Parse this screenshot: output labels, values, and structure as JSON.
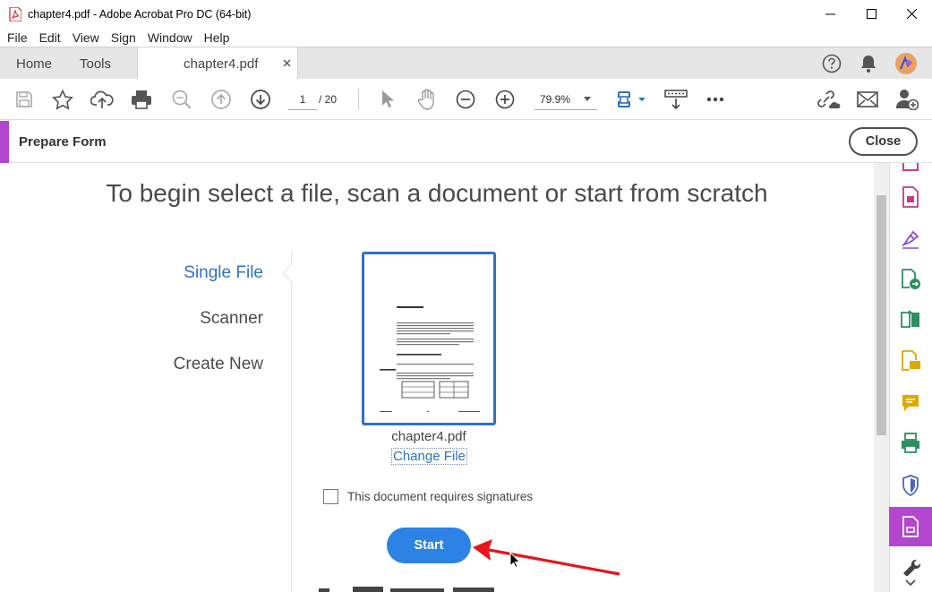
{
  "window": {
    "title": "chapter4.pdf - Adobe Acrobat Pro DC (64-bit)",
    "icons": {
      "app": "acrobat-pdf-icon",
      "minimize": "minimize-icon",
      "maximize": "maximize-icon",
      "close": "close-icon"
    }
  },
  "menu": [
    "File",
    "Edit",
    "View",
    "Sign",
    "Window",
    "Help"
  ],
  "tabs": {
    "home": "Home",
    "tools": "Tools",
    "document": "chapter4.pdf"
  },
  "toolbar": {
    "page_current": "1",
    "page_total": "/ 20",
    "zoom": "79.9%"
  },
  "prepare_form": {
    "title": "Prepare Form",
    "close_label": "Close"
  },
  "main": {
    "heading": "To begin select a file, scan a document or start from scratch",
    "nav": [
      "Single File",
      "Scanner",
      "Create New"
    ],
    "active_nav": "Single File",
    "file_name": "chapter4.pdf",
    "change_file": "Change File",
    "requires_signatures": "This document requires signatures",
    "start_label": "Start"
  },
  "colors": {
    "accent_purple": "#b345ce",
    "link_blue": "#2d72c5",
    "start_blue": "#2d82e6",
    "annotation_red": "#e8141b"
  }
}
